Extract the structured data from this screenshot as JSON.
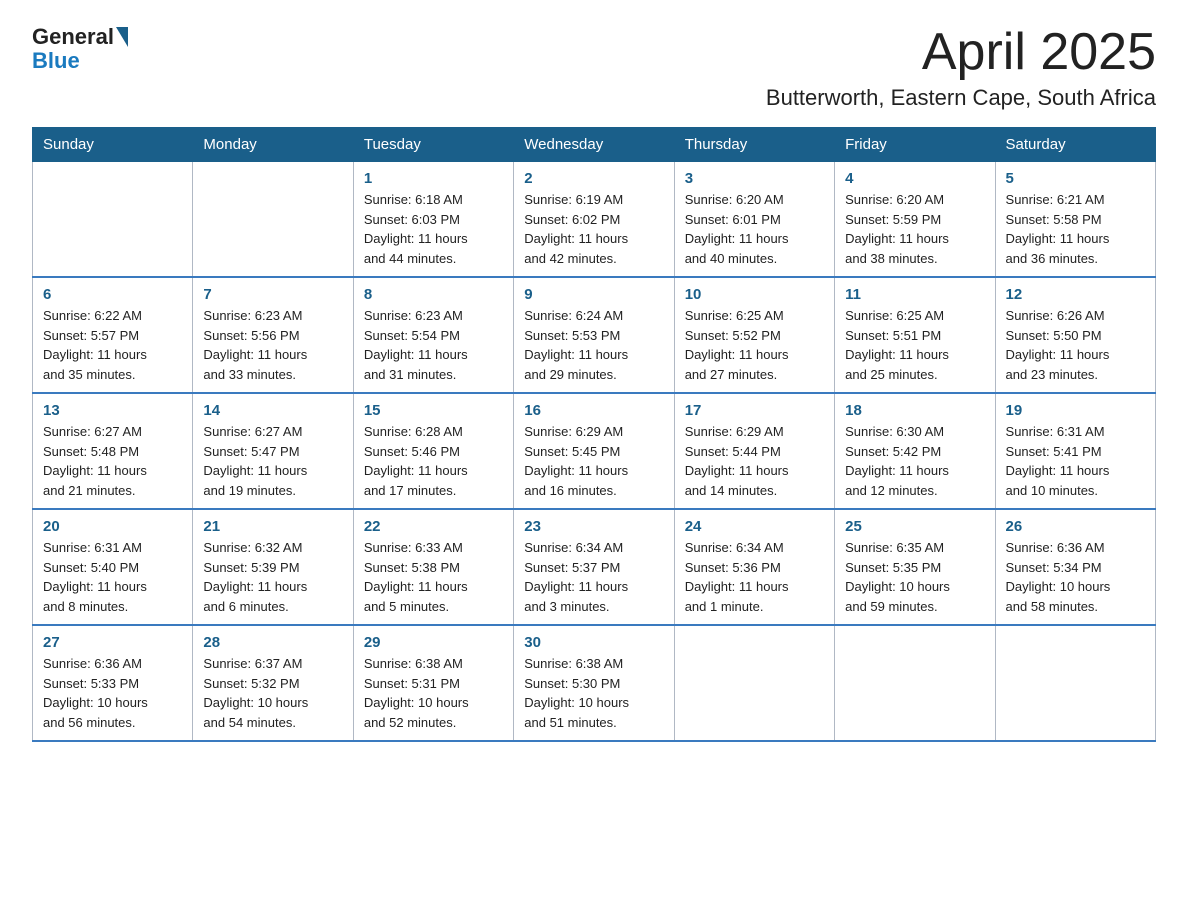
{
  "header": {
    "logo_general": "General",
    "logo_blue": "Blue",
    "month": "April 2025",
    "location": "Butterworth, Eastern Cape, South Africa"
  },
  "weekdays": [
    "Sunday",
    "Monday",
    "Tuesday",
    "Wednesday",
    "Thursday",
    "Friday",
    "Saturday"
  ],
  "weeks": [
    [
      {
        "day": "",
        "info": ""
      },
      {
        "day": "",
        "info": ""
      },
      {
        "day": "1",
        "info": "Sunrise: 6:18 AM\nSunset: 6:03 PM\nDaylight: 11 hours\nand 44 minutes."
      },
      {
        "day": "2",
        "info": "Sunrise: 6:19 AM\nSunset: 6:02 PM\nDaylight: 11 hours\nand 42 minutes."
      },
      {
        "day": "3",
        "info": "Sunrise: 6:20 AM\nSunset: 6:01 PM\nDaylight: 11 hours\nand 40 minutes."
      },
      {
        "day": "4",
        "info": "Sunrise: 6:20 AM\nSunset: 5:59 PM\nDaylight: 11 hours\nand 38 minutes."
      },
      {
        "day": "5",
        "info": "Sunrise: 6:21 AM\nSunset: 5:58 PM\nDaylight: 11 hours\nand 36 minutes."
      }
    ],
    [
      {
        "day": "6",
        "info": "Sunrise: 6:22 AM\nSunset: 5:57 PM\nDaylight: 11 hours\nand 35 minutes."
      },
      {
        "day": "7",
        "info": "Sunrise: 6:23 AM\nSunset: 5:56 PM\nDaylight: 11 hours\nand 33 minutes."
      },
      {
        "day": "8",
        "info": "Sunrise: 6:23 AM\nSunset: 5:54 PM\nDaylight: 11 hours\nand 31 minutes."
      },
      {
        "day": "9",
        "info": "Sunrise: 6:24 AM\nSunset: 5:53 PM\nDaylight: 11 hours\nand 29 minutes."
      },
      {
        "day": "10",
        "info": "Sunrise: 6:25 AM\nSunset: 5:52 PM\nDaylight: 11 hours\nand 27 minutes."
      },
      {
        "day": "11",
        "info": "Sunrise: 6:25 AM\nSunset: 5:51 PM\nDaylight: 11 hours\nand 25 minutes."
      },
      {
        "day": "12",
        "info": "Sunrise: 6:26 AM\nSunset: 5:50 PM\nDaylight: 11 hours\nand 23 minutes."
      }
    ],
    [
      {
        "day": "13",
        "info": "Sunrise: 6:27 AM\nSunset: 5:48 PM\nDaylight: 11 hours\nand 21 minutes."
      },
      {
        "day": "14",
        "info": "Sunrise: 6:27 AM\nSunset: 5:47 PM\nDaylight: 11 hours\nand 19 minutes."
      },
      {
        "day": "15",
        "info": "Sunrise: 6:28 AM\nSunset: 5:46 PM\nDaylight: 11 hours\nand 17 minutes."
      },
      {
        "day": "16",
        "info": "Sunrise: 6:29 AM\nSunset: 5:45 PM\nDaylight: 11 hours\nand 16 minutes."
      },
      {
        "day": "17",
        "info": "Sunrise: 6:29 AM\nSunset: 5:44 PM\nDaylight: 11 hours\nand 14 minutes."
      },
      {
        "day": "18",
        "info": "Sunrise: 6:30 AM\nSunset: 5:42 PM\nDaylight: 11 hours\nand 12 minutes."
      },
      {
        "day": "19",
        "info": "Sunrise: 6:31 AM\nSunset: 5:41 PM\nDaylight: 11 hours\nand 10 minutes."
      }
    ],
    [
      {
        "day": "20",
        "info": "Sunrise: 6:31 AM\nSunset: 5:40 PM\nDaylight: 11 hours\nand 8 minutes."
      },
      {
        "day": "21",
        "info": "Sunrise: 6:32 AM\nSunset: 5:39 PM\nDaylight: 11 hours\nand 6 minutes."
      },
      {
        "day": "22",
        "info": "Sunrise: 6:33 AM\nSunset: 5:38 PM\nDaylight: 11 hours\nand 5 minutes."
      },
      {
        "day": "23",
        "info": "Sunrise: 6:34 AM\nSunset: 5:37 PM\nDaylight: 11 hours\nand 3 minutes."
      },
      {
        "day": "24",
        "info": "Sunrise: 6:34 AM\nSunset: 5:36 PM\nDaylight: 11 hours\nand 1 minute."
      },
      {
        "day": "25",
        "info": "Sunrise: 6:35 AM\nSunset: 5:35 PM\nDaylight: 10 hours\nand 59 minutes."
      },
      {
        "day": "26",
        "info": "Sunrise: 6:36 AM\nSunset: 5:34 PM\nDaylight: 10 hours\nand 58 minutes."
      }
    ],
    [
      {
        "day": "27",
        "info": "Sunrise: 6:36 AM\nSunset: 5:33 PM\nDaylight: 10 hours\nand 56 minutes."
      },
      {
        "day": "28",
        "info": "Sunrise: 6:37 AM\nSunset: 5:32 PM\nDaylight: 10 hours\nand 54 minutes."
      },
      {
        "day": "29",
        "info": "Sunrise: 6:38 AM\nSunset: 5:31 PM\nDaylight: 10 hours\nand 52 minutes."
      },
      {
        "day": "30",
        "info": "Sunrise: 6:38 AM\nSunset: 5:30 PM\nDaylight: 10 hours\nand 51 minutes."
      },
      {
        "day": "",
        "info": ""
      },
      {
        "day": "",
        "info": ""
      },
      {
        "day": "",
        "info": ""
      }
    ]
  ]
}
